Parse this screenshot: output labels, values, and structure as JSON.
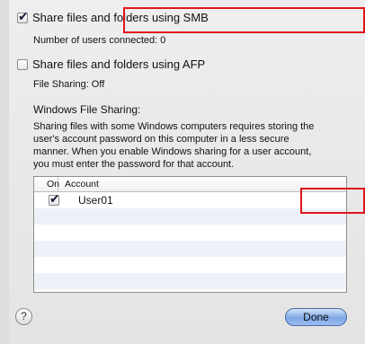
{
  "smb": {
    "label": "Share files and folders using SMB",
    "checked": true,
    "status": "Number of users connected: 0"
  },
  "afp": {
    "label": "Share files and folders using AFP",
    "checked": false,
    "status": "File Sharing: Off"
  },
  "windows_sharing": {
    "heading": "Windows File Sharing:",
    "description_lines": [
      "Sharing files with some Windows computers requires storing the",
      "user's account password on this computer in a less secure",
      "manner.  When you enable Windows sharing for a user account,",
      "you must enter the password for that account."
    ]
  },
  "table": {
    "col_on": "On",
    "col_account": "Account",
    "rows": [
      {
        "name": "User01",
        "checked": true
      }
    ]
  },
  "buttons": {
    "help": "?",
    "done": "Done"
  },
  "colors": {
    "highlight": "#e0151b",
    "done_button": "#7fa7e6"
  }
}
